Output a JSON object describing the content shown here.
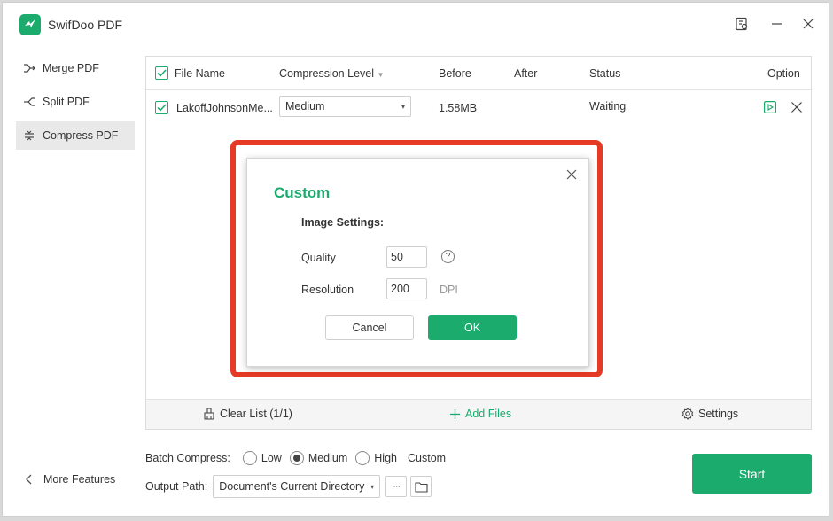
{
  "app": {
    "title": "SwifDoo PDF",
    "accent": "#1aab6d",
    "highlight": "#e53a26"
  },
  "sidebar": {
    "items": [
      {
        "label": "Merge PDF",
        "icon": "merge-icon"
      },
      {
        "label": "Split PDF",
        "icon": "split-icon"
      },
      {
        "label": "Compress PDF",
        "icon": "compress-icon",
        "active": true
      }
    ],
    "more_features": "More Features"
  },
  "table": {
    "headers": {
      "file_name": "File Name",
      "compression_level": "Compression Level",
      "before": "Before",
      "after": "After",
      "status": "Status",
      "option": "Option"
    },
    "rows": [
      {
        "file_name": "LakoffJohnsonMe...",
        "compression_level": "Medium",
        "before": "1.58MB",
        "after": "",
        "status": "Waiting",
        "checked": true
      }
    ]
  },
  "footer": {
    "clear_list": "Clear List (1/1)",
    "add_files": "Add Files",
    "settings": "Settings"
  },
  "batch": {
    "label": "Batch Compress:",
    "options": [
      "Low",
      "Medium",
      "High"
    ],
    "selected": "Medium",
    "custom": "Custom"
  },
  "output": {
    "label": "Output Path:",
    "value": "Document's Current Directory",
    "more": "···"
  },
  "start": "Start",
  "dialog": {
    "title": "Custom",
    "subtitle": "Image Settings:",
    "quality_label": "Quality",
    "quality_value": "50",
    "resolution_label": "Resolution",
    "resolution_value": "200",
    "resolution_unit": "DPI",
    "help": "?",
    "cancel": "Cancel",
    "ok": "OK"
  }
}
